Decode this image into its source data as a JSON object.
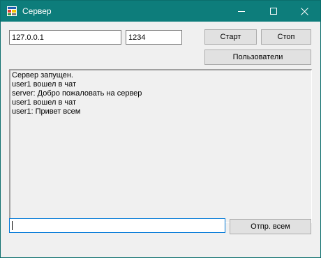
{
  "window": {
    "title": "Сервер",
    "controls": {
      "minimize": "minimize-icon",
      "maximize": "maximize-icon",
      "close": "close-icon"
    }
  },
  "connection": {
    "ip": "127.0.0.1",
    "port": "1234"
  },
  "buttons": {
    "start": "Старт",
    "stop": "Стоп",
    "users": "Пользователи",
    "send_all": "Отпр. всем"
  },
  "log": {
    "lines": [
      "Сервер запущен.",
      "user1 вошел в чат",
      "server: Добро пожаловать на сервер",
      "user1 вошел в чат",
      "user1: Привет всем"
    ]
  },
  "message": {
    "value": ""
  },
  "colors": {
    "titlebar": "#0d7d7b",
    "background": "#f0f0f0",
    "button": "#e1e1e1",
    "focus_border": "#0078d7"
  }
}
